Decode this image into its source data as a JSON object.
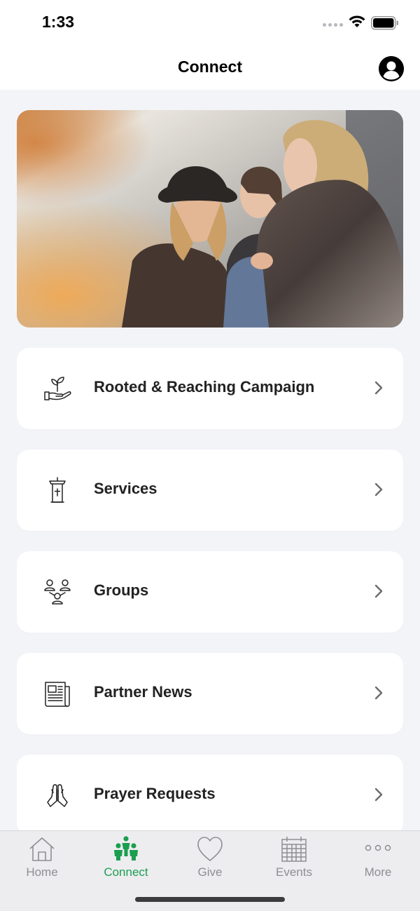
{
  "status_bar": {
    "time": "1:33"
  },
  "header": {
    "title": "Connect",
    "profile_icon": "person-circle-icon"
  },
  "hero": {
    "image_description_icon": "hero-photo"
  },
  "menu": {
    "items": [
      {
        "label": "Rooted & Reaching Campaign",
        "icon": "hand-sprout-icon"
      },
      {
        "label": "Services",
        "icon": "pulpit-icon"
      },
      {
        "label": "Groups",
        "icon": "group-people-icon"
      },
      {
        "label": "Partner News",
        "icon": "newspaper-icon"
      },
      {
        "label": "Prayer Requests",
        "icon": "praying-hands-icon"
      }
    ]
  },
  "tab_bar": {
    "active_color": "#1a9e4f",
    "inactive_color": "#8e8e93",
    "tabs": [
      {
        "label": "Home",
        "icon": "house-icon"
      },
      {
        "label": "Connect",
        "icon": "people-connect-icon"
      },
      {
        "label": "Give",
        "icon": "heart-icon"
      },
      {
        "label": "Events",
        "icon": "calendar-icon"
      },
      {
        "label": "More",
        "icon": "ellipsis-icon"
      }
    ]
  }
}
